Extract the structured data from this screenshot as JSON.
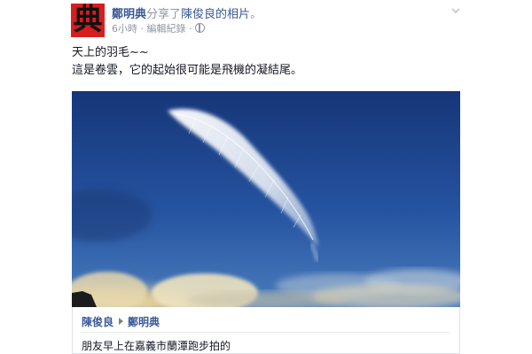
{
  "post": {
    "author": "鄭明典",
    "avatar_char": "典",
    "shared_text": "分享了",
    "photo_owner": "陳俊良",
    "photo_suffix": "的相片",
    "period": "。",
    "time": "6小時",
    "meta_sep": " · ",
    "edit_history": "編輯紀錄",
    "text_line1": "天上的羽毛~~",
    "text_line2": "這是卷雲，它的起始很可能是飛機的凝結尾。"
  },
  "shared_photo": {
    "owner": "陳俊良",
    "target": "鄭明典",
    "caption": "朋友早上在嘉義市蘭潭跑步拍的"
  },
  "colors": {
    "link": "#3b5998",
    "meta_gray": "#9197a3",
    "avatar_red": "#d71e1e",
    "sky_top": "#1c3f88",
    "sky_bottom": "#3d6fb5"
  },
  "icons": [
    "chevron-down-icon",
    "globe-icon",
    "arrow-right-icon"
  ]
}
